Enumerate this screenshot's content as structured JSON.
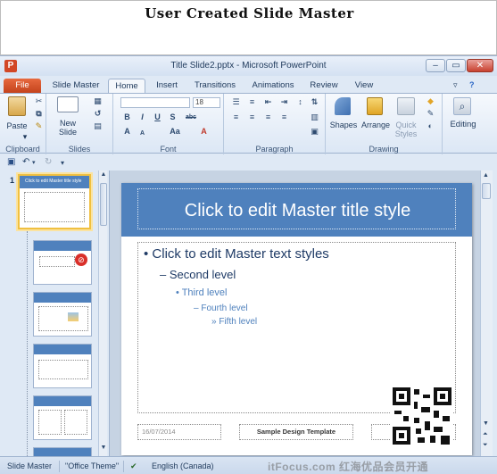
{
  "caption": "User Created Slide Master",
  "window": {
    "title": "Title Slide2.pptx - Microsoft PowerPoint",
    "app_icon": "P",
    "controls": [
      "–",
      "▭",
      "✕"
    ]
  },
  "tabs": [
    {
      "label": "File"
    },
    {
      "label": "Slide Master"
    },
    {
      "label": "Home",
      "active": true
    },
    {
      "label": "Insert"
    },
    {
      "label": "Transitions"
    },
    {
      "label": "Animations"
    },
    {
      "label": "Review"
    },
    {
      "label": "View"
    }
  ],
  "ribbon": {
    "clipboard": {
      "label": "Clipboard",
      "paste": "Paste"
    },
    "slides": {
      "label": "Slides",
      "new_slide": "New Slide"
    },
    "font": {
      "label": "Font",
      "size": "18",
      "bold": "B",
      "italic": "I",
      "underline": "U",
      "shadow": "S",
      "strike": "abc",
      "font_grow": "A",
      "font_shrink": "A",
      "case": "Aa",
      "clear": "A"
    },
    "paragraph": {
      "label": "Paragraph"
    },
    "drawing": {
      "label": "Drawing",
      "shapes": "Shapes",
      "arrange": "Arrange",
      "quick_styles": "Quick Styles"
    },
    "editing": {
      "label": "Editing"
    }
  },
  "thumbnails": {
    "selected_number": "1",
    "master_title": "Click to edit Master title style"
  },
  "slide": {
    "title": "Click to edit Master title style",
    "levels": [
      "• Click to edit Master text styles",
      "– Second level",
      "• Third level",
      "– Fourth level",
      "» Fifth level"
    ],
    "date": "16/07/2014",
    "footer": "Sample Design Template"
  },
  "status": {
    "view": "Slide Master",
    "theme": "\"Office Theme\"",
    "language": "English (Canada)",
    "watermark": "itFocus.com 红海优品会员开通"
  },
  "colors": {
    "accent": "#4f81bd",
    "file_tab": "#d24726",
    "title_text": "#ffffff"
  }
}
